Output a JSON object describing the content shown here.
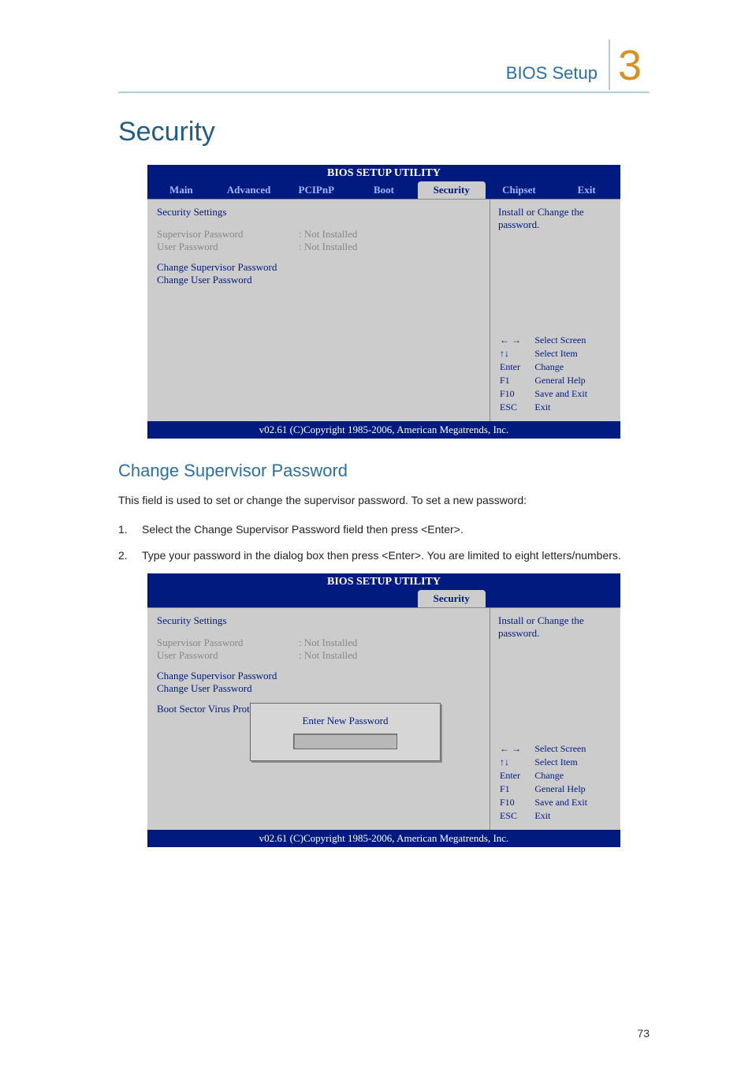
{
  "header": {
    "title": "BIOS Setup",
    "chapter": "3"
  },
  "page_number": "73",
  "section_title": "Security",
  "sub_title": "Change Supervisor Password",
  "paragraphs": {
    "intro": "This field is used to set or change the supervisor password. To set a new password:",
    "step1_num": "1.",
    "step1_txt": "Select the Change Supervisor Password field then press <Enter>.",
    "step2_num": "2.",
    "step2_txt": "Type your password in the dialog box then press <Enter>. You are limited to eight letters/numbers."
  },
  "bios": {
    "utility_title": "BIOS SETUP UTILITY",
    "tabs": [
      "Main",
      "Advanced",
      "PCIPnP",
      "Boot",
      "Security",
      "Chipset",
      "Exit"
    ],
    "active_tab": "Security",
    "section_head": "Security Settings",
    "rows": [
      {
        "k": "Supervisor Password",
        "v": ": Not Installed"
      },
      {
        "k": "User Password",
        "v": ": Not Installed"
      }
    ],
    "links": [
      "Change Supervisor Password",
      "Change User Password"
    ],
    "extra_link": "Boot Sector Virus Prote",
    "help_text": "Install or Change the password.",
    "nav": [
      {
        "key": "← →",
        "desc": "Select Screen"
      },
      {
        "key": "↑↓",
        "desc": "Select Item"
      },
      {
        "key": "Enter",
        "desc": "Change"
      },
      {
        "key": "F1",
        "desc": "General Help"
      },
      {
        "key": "F10",
        "desc": "Save and Exit"
      },
      {
        "key": "ESC",
        "desc": "Exit"
      }
    ],
    "footer": "v02.61 (C)Copyright 1985-2006, American Megatrends, Inc.",
    "dialog_title": "Enter New Password"
  }
}
